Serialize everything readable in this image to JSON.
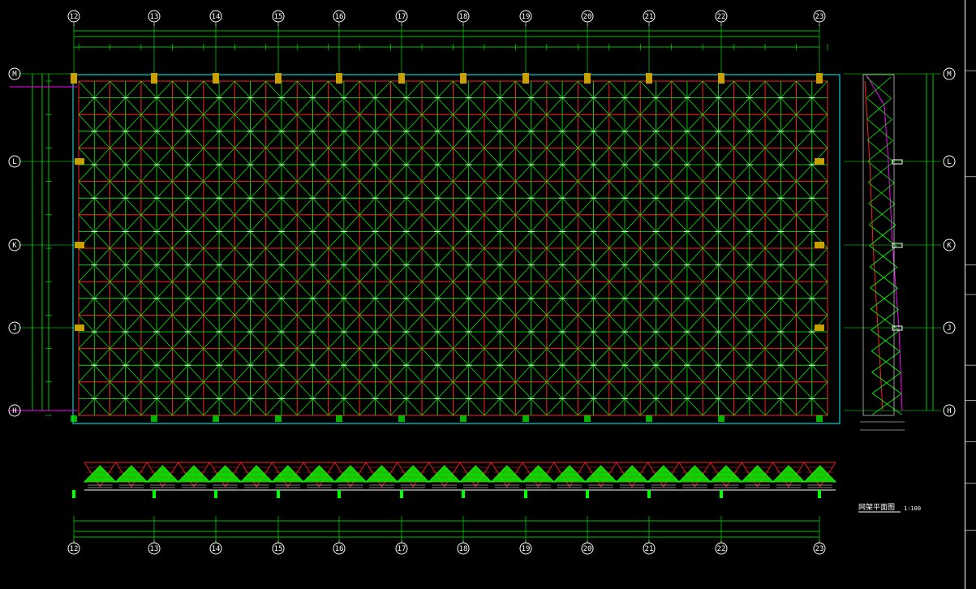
{
  "drawing": {
    "title": "网架平面图",
    "scale": "1:100",
    "colors": {
      "background": "#000000",
      "grid_line": "#00ff00",
      "red_chord": "#ff2020",
      "white": "#ffffff",
      "cyan": "#00ffff",
      "support": "#c8a000",
      "magenta": "#ff00ff"
    }
  },
  "axes": {
    "top_columns": [
      "12",
      "13",
      "14",
      "15",
      "16",
      "17",
      "18",
      "19",
      "20",
      "21",
      "22",
      "23"
    ],
    "bottom_columns": [
      "12",
      "13",
      "14",
      "15",
      "16",
      "17",
      "18",
      "19",
      "20",
      "21",
      "22",
      "23"
    ],
    "left_rows": [
      "M",
      "L",
      "K",
      "J",
      "H"
    ],
    "right_rows": [
      "M",
      "L",
      "K",
      "J",
      "H"
    ]
  }
}
